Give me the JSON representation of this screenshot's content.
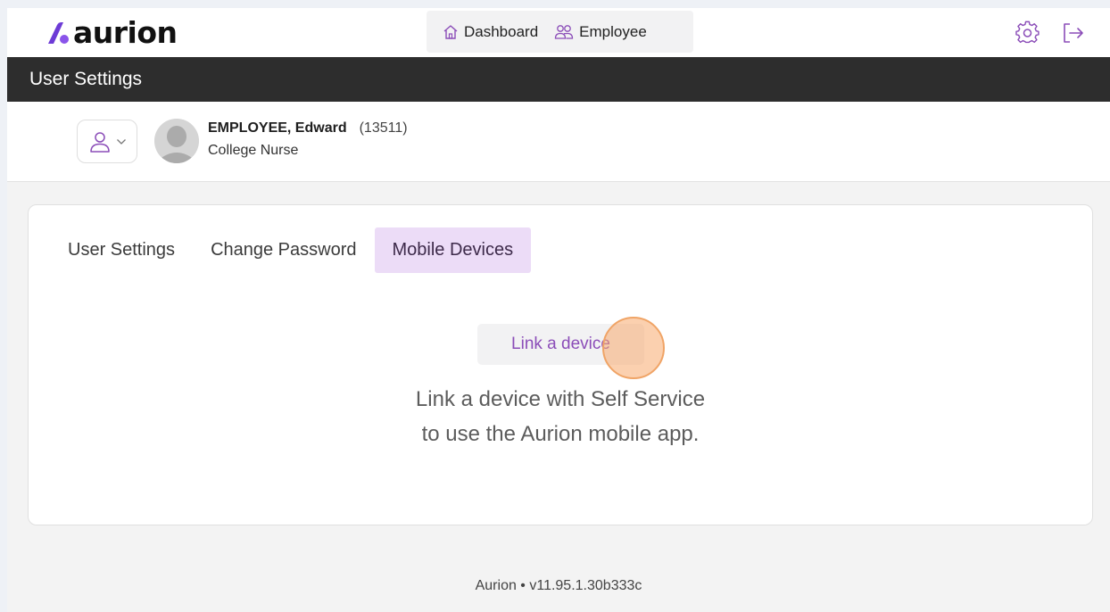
{
  "brand": {
    "name": "aurion",
    "accent": "#7b3fe0"
  },
  "nav": {
    "items": [
      {
        "label": "Dashboard",
        "icon": "home-icon"
      },
      {
        "label": "Employee",
        "icon": "users-icon"
      }
    ]
  },
  "header_actions": {
    "settings_icon": "gear-icon",
    "logout_icon": "logout-icon"
  },
  "page": {
    "title": "User Settings"
  },
  "employee": {
    "name": "EMPLOYEE, Edward",
    "id": "(13511)",
    "role": "College Nurse",
    "selector_icon": "user-icon"
  },
  "tabs": [
    {
      "label": "User Settings",
      "active": false
    },
    {
      "label": "Change Password",
      "active": false
    },
    {
      "label": "Mobile Devices",
      "active": true
    }
  ],
  "mobile_devices": {
    "link_button": "Link a device",
    "description_line1": "Link a device with Self Service",
    "description_line2": "to use the Aurion mobile app."
  },
  "footer": {
    "version": "Aurion • v11.95.1.30b333c"
  },
  "colors": {
    "titlebar_bg": "#2d2d2d",
    "active_tab_bg": "#ecdcf7",
    "link_text": "#8b4db8",
    "click_marker": "#f7aa6e"
  }
}
